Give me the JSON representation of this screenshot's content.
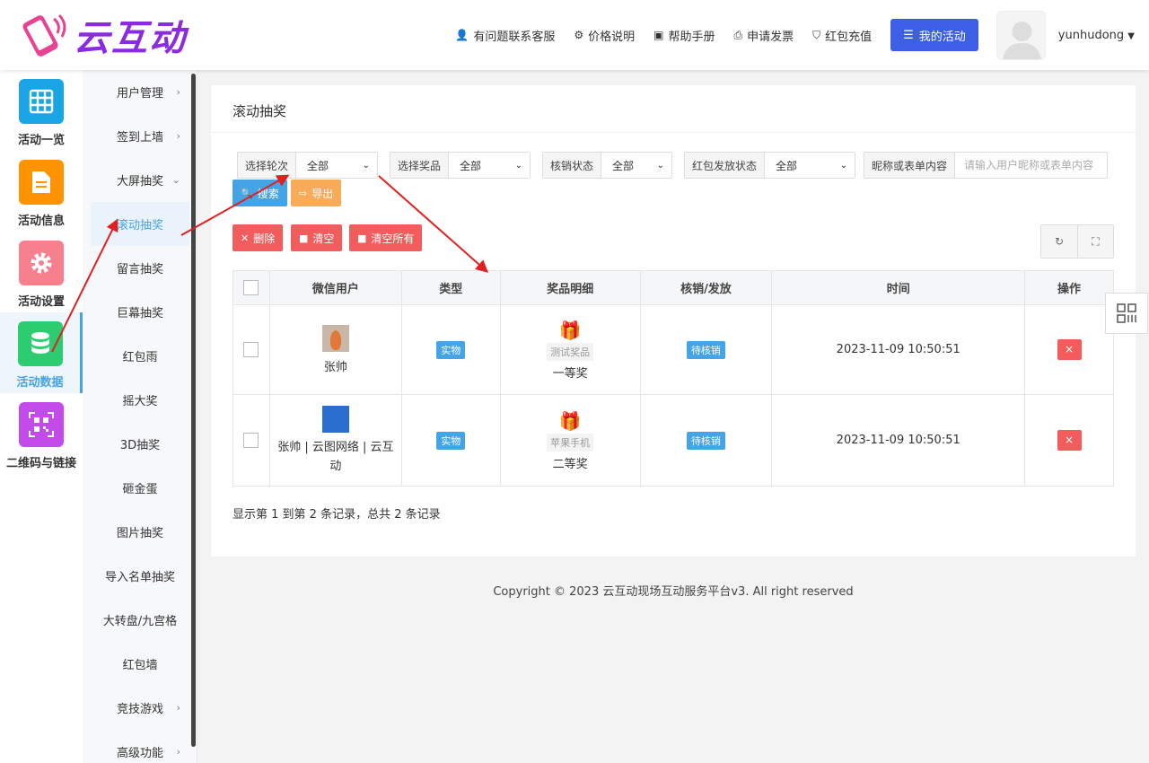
{
  "brand": {
    "name": "云互动"
  },
  "header": {
    "nav": [
      {
        "label": "有问题联系客服",
        "icon": "user-plus-icon"
      },
      {
        "label": "价格说明",
        "icon": "gear-icon"
      },
      {
        "label": "帮助手册",
        "icon": "book-icon"
      },
      {
        "label": "申请发票",
        "icon": "printer-icon"
      },
      {
        "label": "红包充值",
        "icon": "shield-check-icon"
      }
    ],
    "my_activity": "我的活动",
    "username": "yunhudong"
  },
  "sidebar": {
    "items": [
      {
        "label": "活动一览",
        "icon": "grid-icon",
        "color": "#1aa6e6"
      },
      {
        "label": "活动信息",
        "icon": "document-icon",
        "color": "#ff9400"
      },
      {
        "label": "活动设置",
        "icon": "gear-icon",
        "color": "#f7808e"
      },
      {
        "label": "活动数据",
        "icon": "database-icon",
        "color": "#2ecc71",
        "active": true
      },
      {
        "label": "二维码与链接",
        "icon": "qrcode-icon",
        "color": "#c34bea"
      }
    ]
  },
  "submenu": {
    "items": [
      {
        "label": "用户管理",
        "chevron": "›"
      },
      {
        "label": "签到上墙",
        "chevron": "›"
      },
      {
        "label": "大屏抽奖",
        "chevron": "⌄"
      },
      {
        "label": "滚动抽奖",
        "active": true
      },
      {
        "label": "留言抽奖"
      },
      {
        "label": "巨幕抽奖"
      },
      {
        "label": "红包雨"
      },
      {
        "label": "摇大奖"
      },
      {
        "label": "3D抽奖"
      },
      {
        "label": "砸金蛋"
      },
      {
        "label": "图片抽奖"
      },
      {
        "label": "导入名单抽奖"
      },
      {
        "label": "大转盘/九宫格"
      },
      {
        "label": "红包墙"
      },
      {
        "label": "竞技游戏",
        "chevron": "›"
      },
      {
        "label": "高级功能",
        "chevron": "›"
      }
    ]
  },
  "panel": {
    "title": "滚动抽奖",
    "filters": {
      "round": {
        "label": "选择轮次",
        "value": "全部"
      },
      "prize": {
        "label": "选择奖品",
        "value": "全部"
      },
      "verify": {
        "label": "核销状态",
        "value": "全部"
      },
      "redpack": {
        "label": "红包发放状态",
        "value": "全部"
      },
      "keyword": {
        "label": "昵称或表单内容",
        "placeholder": "请输入用户昵称或表单内容"
      }
    },
    "buttons": {
      "search": "搜索",
      "export": "导出",
      "delete": "删除",
      "clear": "清空",
      "clear_all": "清空所有"
    },
    "table": {
      "headers": {
        "user": "微信用户",
        "type": "类型",
        "prize": "奖品明细",
        "status": "核销/发放",
        "time": "时间",
        "action": "操作"
      },
      "rows": [
        {
          "user": "张帅",
          "type": "实物",
          "prize_name": "测试奖品",
          "prize_level": "一等奖",
          "status": "待核销",
          "time": "2023-11-09 10:50:51",
          "action": "×"
        },
        {
          "user": "张帅 | 云图网络 | 云互动",
          "type": "实物",
          "prize_name": "苹果手机",
          "prize_level": "二等奖",
          "status": "待核销",
          "time": "2023-11-09 10:50:51",
          "action": "×"
        }
      ]
    },
    "pagination": "显示第 1 到第 2 条记录，总共 2 条记录"
  },
  "footer": {
    "copyright": "Copyright © 2023 云互动现场互动服务平台v3. All right reserved"
  }
}
